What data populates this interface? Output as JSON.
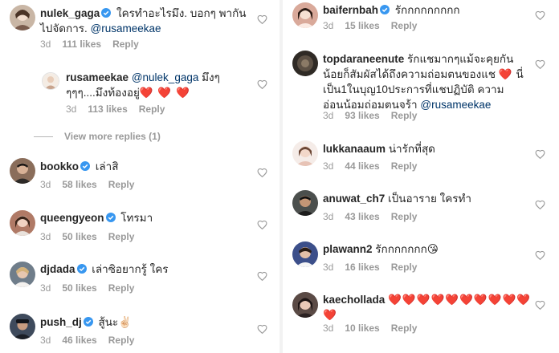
{
  "left": {
    "comments": [
      {
        "username": "nulek_gaga",
        "text": "ใครทำอะไรมึง. บอกๆ พากันไปจัดการ.",
        "mention": "@rusameekae",
        "time": "3d",
        "likes": "111 likes",
        "reply": "Reply",
        "avatar_color": "#c9b6a5"
      },
      {
        "username": "rusameekae",
        "mention": "@nulek_gaga",
        "text": "มึงๆ ๆๆๆ....มึงท้องอยู่",
        "hearts": "❤️ ❤️ ❤️",
        "time": "3d",
        "likes": "113 likes",
        "reply": "Reply",
        "avatar_color": "#e8d9cc"
      },
      {
        "username": "bookko",
        "text": "เล่าสิ",
        "time": "3d",
        "likes": "58 likes",
        "reply": "Reply",
        "avatar_color": "#8a6d5a"
      },
      {
        "username": "queengyeon",
        "text": "โทรมา",
        "time": "3d",
        "likes": "50 likes",
        "reply": "Reply",
        "avatar_color": "#b07a66"
      },
      {
        "username": "djdada",
        "text": "เล่าซิอยากรู้ ใคร",
        "time": "3d",
        "likes": "50 likes",
        "reply": "Reply",
        "avatar_color": "#6f7d8a"
      },
      {
        "username": "push_dj",
        "text": "สู้นะ",
        "emoji": "✌🏻",
        "time": "3d",
        "likes": "46 likes",
        "reply": "Reply",
        "avatar_color": "#3e4a5c"
      }
    ],
    "view_more": "View more replies (1)"
  },
  "right": {
    "comments": [
      {
        "username": "baifernbah",
        "text": "รักกกกกกกกก",
        "time": "3d",
        "likes": "15 likes",
        "reply": "Reply",
        "avatar_color": "#d9a99a"
      },
      {
        "username": "topdaraneenute",
        "text": "รักแชมากๆแม้จะคุยกันน้อยก็สัมผัสได้ถึงความถ่อมตนของแช",
        "heart": "❤️",
        "text2": "นี่เป็น1ในบุญ10ประการที่แชปฏิบัติ ความอ่อนน้อมถ่อมตนจร้า",
        "mention": "@rusameekae",
        "time": "3d",
        "likes": "93 likes",
        "reply": "Reply",
        "avatar_color": "#2f2a25"
      },
      {
        "username": "lukkanaaum",
        "text": "น่ารักที่สุด",
        "time": "3d",
        "likes": "44 likes",
        "reply": "Reply",
        "avatar_color": "#e7c3b6"
      },
      {
        "username": "anuwat_ch7",
        "text": "เป็นอาราย ใครทำ",
        "time": "3d",
        "likes": "43 likes",
        "reply": "Reply",
        "avatar_color": "#4b4f4d"
      },
      {
        "username": "plawann2",
        "text": "รักกกกกกก",
        "emoji": "😘",
        "time": "3d",
        "likes": "16 likes",
        "reply": "Reply",
        "avatar_color": "#3c4f8a"
      },
      {
        "username": "kaechollada",
        "hearts": "❤️❤️❤️❤️❤️❤️❤️❤️❤️❤️❤️",
        "time": "3d",
        "likes": "10 likes",
        "reply": "Reply",
        "avatar_color": "#5a4a45"
      }
    ]
  },
  "colors": {
    "username": "#262626",
    "meta": "#999999",
    "mention": "#003569",
    "heart": "#ed4956",
    "verified": "#3897f0"
  }
}
